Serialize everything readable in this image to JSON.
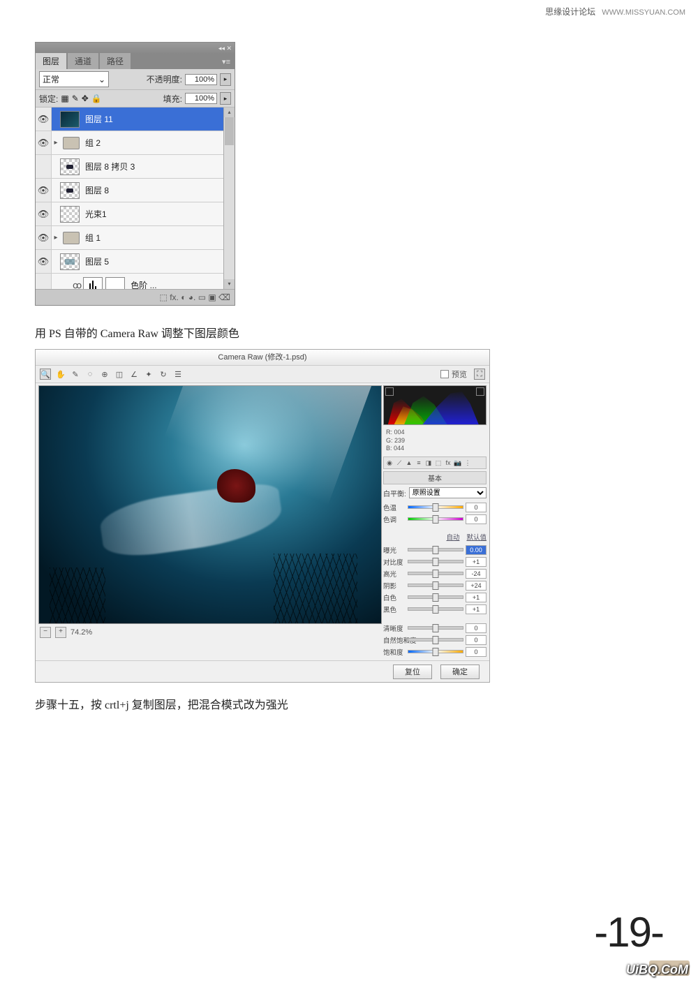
{
  "watermark": {
    "site": "思缘设计论坛",
    "url": "WWW.MISSYUAN.COM"
  },
  "layers_panel": {
    "header_icons": "◂◂ ✕",
    "tabs": [
      "图层",
      "通道",
      "路径"
    ],
    "menu_icon": "▾≡",
    "blend_mode": "正常",
    "opacity_label": "不透明度:",
    "opacity_value": "100%",
    "lock_label": "锁定:",
    "fill_label": "填充:",
    "fill_value": "100%",
    "layers": [
      {
        "visible": true,
        "type": "image",
        "name": "图层 11",
        "selected": true
      },
      {
        "visible": true,
        "type": "group",
        "name": "组 2"
      },
      {
        "visible": false,
        "type": "checker",
        "name": "图层 8 拷贝 3"
      },
      {
        "visible": true,
        "type": "checker",
        "name": "图层 8"
      },
      {
        "visible": true,
        "type": "checker",
        "name": "光束1"
      },
      {
        "visible": true,
        "type": "group",
        "name": "组 1"
      },
      {
        "visible": true,
        "type": "checker",
        "name": "图层 5"
      }
    ],
    "adjustment": {
      "name": "色阶 ..."
    },
    "footer_icons": "⬚  fx. ◐ ◕. ▭ ▣ ⌫"
  },
  "text1": "用 PS 自带的 Camera Raw 调整下图层颜色",
  "camera_raw": {
    "title": "Camera Raw (修改-1.psd)",
    "preview_label": "预览",
    "rgb": {
      "r": "R: 004",
      "g": "G: 239",
      "b": "B: 044"
    },
    "section_title": "基本",
    "wb_label": "白平衡:",
    "wb_value": "原照设置",
    "auto": "自动",
    "default": "默认值",
    "sliders": [
      {
        "label": "色温",
        "value": "0",
        "grad": "grad"
      },
      {
        "label": "色调",
        "value": "0",
        "grad": "grad2"
      },
      {
        "label": "曝光",
        "value": "0.00",
        "highlight": true
      },
      {
        "label": "对比度",
        "value": "+1"
      },
      {
        "label": "高光",
        "value": "-24"
      },
      {
        "label": "阴影",
        "value": "+24"
      },
      {
        "label": "白色",
        "value": "+1"
      },
      {
        "label": "黑色",
        "value": "+1"
      },
      {
        "label": "清晰度",
        "value": "0"
      },
      {
        "label": "自然饱和度",
        "value": "0"
      },
      {
        "label": "饱和度",
        "value": "0",
        "grad": "grad"
      }
    ],
    "zoom": "74.2%",
    "btn_reset": "复位",
    "btn_ok": "确定"
  },
  "text2": "步骤十五，按 crtl+j 复制图层，把混合模式改为强光",
  "page_number": "19",
  "logo": "UiBQ.CoM"
}
